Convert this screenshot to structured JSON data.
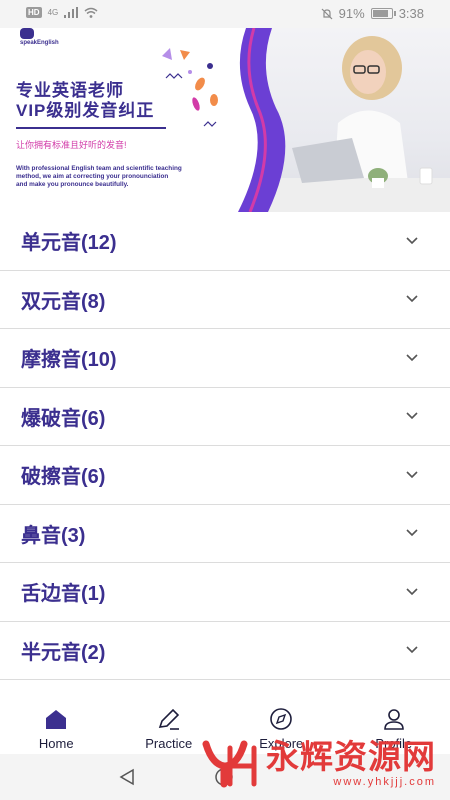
{
  "status_bar": {
    "hd": "HD",
    "network": "4G",
    "battery": "91%",
    "battery_level": 0.91,
    "time": "3:38"
  },
  "banner": {
    "brand": "speakEnglish",
    "headline1": "专业英语老师",
    "headline2": "VIP级别发音纠正",
    "tagline": "让你拥有标准且好听的发音!",
    "description_lines": [
      "With professional English team and scientific teaching",
      "method, we aim at correcting your pronounciation",
      "and make you pronounce beautifully."
    ],
    "colors": {
      "brand_purple": "#3b2f8f",
      "accent_pink": "#d23ba8",
      "wave_purple": "#6b3fd4",
      "deco_orange": "#f28c4a"
    }
  },
  "categories": [
    {
      "label": "单元音(12)"
    },
    {
      "label": "双元音(8)"
    },
    {
      "label": "摩擦音(10)"
    },
    {
      "label": "爆破音(6)"
    },
    {
      "label": "破擦音(6)"
    },
    {
      "label": "鼻音(3)"
    },
    {
      "label": "舌边音(1)"
    },
    {
      "label": "半元音(2)"
    }
  ],
  "bottom_nav": {
    "tabs": [
      {
        "label": "Home",
        "icon": "home-icon",
        "active": true
      },
      {
        "label": "Practice",
        "icon": "pencil-icon",
        "active": false
      },
      {
        "label": "Explore",
        "icon": "compass-icon",
        "active": false
      },
      {
        "label": "Profile",
        "icon": "person-icon",
        "active": false
      }
    ],
    "active_color": "#3b2f8f"
  },
  "watermark": {
    "text": "永辉资源网",
    "url": "www.yhkjjj.com",
    "color": "#e23a3a"
  }
}
